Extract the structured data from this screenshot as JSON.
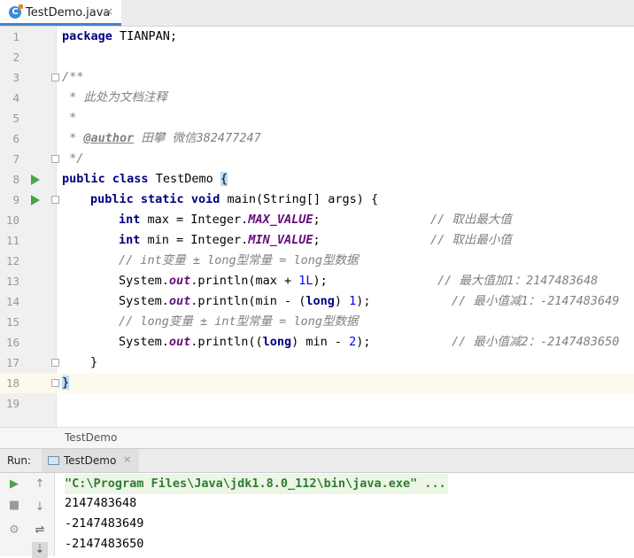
{
  "tab": {
    "file_name": "TestDemo.java",
    "close_glyph": "×",
    "icon_letter": "C"
  },
  "editor": {
    "line_numbers": [
      "1",
      "2",
      "3",
      "4",
      "5",
      "6",
      "7",
      "8",
      "9",
      "10",
      "11",
      "12",
      "13",
      "14",
      "15",
      "16",
      "17",
      "18",
      "19"
    ],
    "code": {
      "l1_kw": "package",
      "l1_rest": " TIANPAN;",
      "l3": "/**",
      "l4": " * 此处为文档注释",
      "l5": " *",
      "l6_pre": " * ",
      "l6_tag": "@author",
      "l6_rest": " 田攀 微信382477247",
      "l7": " */",
      "l8_kw1": "public",
      "l8_kw2": "class",
      "l8_name": " TestDemo ",
      "l8_brace": "{",
      "l9_kw1": "public",
      "l9_kw2": "static",
      "l9_kw3": "void",
      "l9_rest": " main(String[] args) {",
      "l10_kw": "int",
      "l10_mid": " max = Integer.",
      "l10_const": "MAX_VALUE",
      "l10_end": ";",
      "l10_comment": "// 取出最大值",
      "l11_kw": "int",
      "l11_mid": " min = Integer.",
      "l11_const": "MIN_VALUE",
      "l11_end": ";",
      "l11_comment": "// 取出最小值",
      "l12": "// int变量 ± long型常量 = long型数据",
      "l13_a": "System.",
      "l13_out": "out",
      "l13_b": ".println(max + ",
      "l13_num": "1L",
      "l13_c": ");",
      "l13_comment": "// 最大值加1：2147483648",
      "l14_a": "System.",
      "l14_out": "out",
      "l14_b": ".println(min - (",
      "l14_kw": "long",
      "l14_c": ") ",
      "l14_num": "1",
      "l14_d": ");",
      "l14_comment": "// 最小值减1：-2147483649",
      "l15": "// long变量 ± int型常量 = long型数据",
      "l16_a": "System.",
      "l16_out": "out",
      "l16_b": ".println((",
      "l16_kw": "long",
      "l16_c": ") min - ",
      "l16_num": "2",
      "l16_d": ");",
      "l16_comment": "// 最小值减2：-2147483650",
      "l17": "}",
      "l18": "}"
    }
  },
  "breadcrumb": {
    "label": "TestDemo"
  },
  "run_panel": {
    "label": "Run:",
    "tab_name": "TestDemo",
    "close_glyph": "×",
    "command": "\"C:\\Program Files\\Java\\jdk1.8.0_112\\bin\\java.exe\" ...",
    "output": [
      "2147483648",
      "-2147483649",
      "-2147483650"
    ]
  },
  "icons": {
    "run": "play-icon",
    "stop": "stop-icon",
    "rerun": "gear-icon",
    "up": "arrow-up-icon",
    "down": "arrow-down-icon",
    "wrap": "soft-wrap-icon",
    "scroll": "scroll-to-end-icon",
    "colors": {
      "run": "#49a546",
      "accent": "#4083c9",
      "current_line": "#fcfaed"
    }
  }
}
